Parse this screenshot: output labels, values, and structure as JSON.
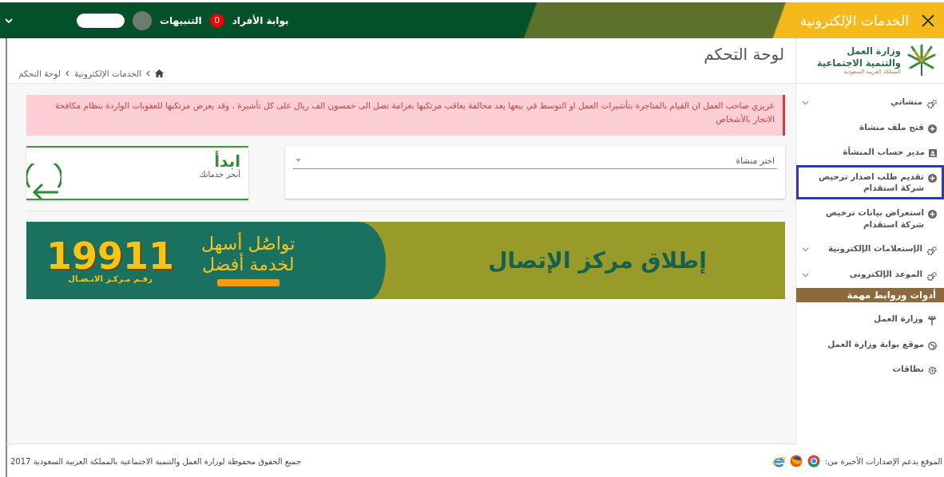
{
  "topbar": {
    "title": "الخدمات الإلكترونية",
    "portal_link": "بوابة الأفراد",
    "notification_count": "0",
    "notifications_label": "التنبيهات"
  },
  "sidebar": {
    "logo": {
      "line_1": "وزارة العمل",
      "line_2": "والتنمية الاجتماعية",
      "line_3": "المملكة العربية السعودية"
    },
    "items": [
      {
        "kind": "group",
        "label": "منشاتي",
        "highlighted": false
      },
      {
        "kind": "action",
        "label": "فتح ملف منشاة",
        "highlighted": false
      },
      {
        "kind": "profile",
        "label": "مدير حساب المنشأة",
        "highlighted": false
      },
      {
        "kind": "action",
        "label": "تقديم طلب اصدار ترخيص شركة استقدام",
        "highlighted": true
      },
      {
        "kind": "action",
        "label": "استعراض بيانات ترخيص شركة استقدام",
        "highlighted": false
      },
      {
        "kind": "group",
        "label": "الإستعلامات الإلكترونية",
        "highlighted": false
      },
      {
        "kind": "group",
        "label": "الموعد الإلكترونى",
        "highlighted": false
      },
      {
        "kind": "heading",
        "label": "أدوات وروابط مهمة",
        "highlighted": false
      },
      {
        "kind": "ministry",
        "label": "وزارة العمل",
        "highlighted": false
      },
      {
        "kind": "website",
        "label": "موقع بوابة وزارة العمل",
        "highlighted": false
      },
      {
        "kind": "settings",
        "label": "نطاقات",
        "highlighted": false
      }
    ]
  },
  "main": {
    "page_title": "لوحة التحكم",
    "breadcrumb": [
      "الخدمات الإلكترونية",
      "لوحة التحكم"
    ],
    "alert": "عزيزي صاحب العمل ان القيام بالمتاجرة بتأشيرات العمل او التوسط في بيعها يعد مخالفة يعاقب مرتكبها بغرامة تصل الى خمسون الف ريال على كل تأشيرة ، وقد يعرض مرتكبها للعقوبات الواردة بنظام مكافحة الاتجار بالأشخاص",
    "select": {
      "placeholder": "اختر منشاة"
    },
    "start_card": {
      "title": "ابدأ",
      "subtitle": "أنجز خدماتك"
    },
    "banner": {
      "headline": "إطلاق مركز الإتصال",
      "tagline_1": "تواصُل أسهل",
      "tagline_2": "لخدمة أفضل",
      "number": "19911",
      "number_caption": "رقـم مـركـز الاتـصـال"
    }
  },
  "footer": {
    "browsers_note": "الموقع يدعم الإصدارات الأخيرة من:",
    "copyright": "جميع الحقوق محفوظة لوزارة العمل والتنمية الاجتماعية بالمملكة العربية السعودية 2017"
  }
}
